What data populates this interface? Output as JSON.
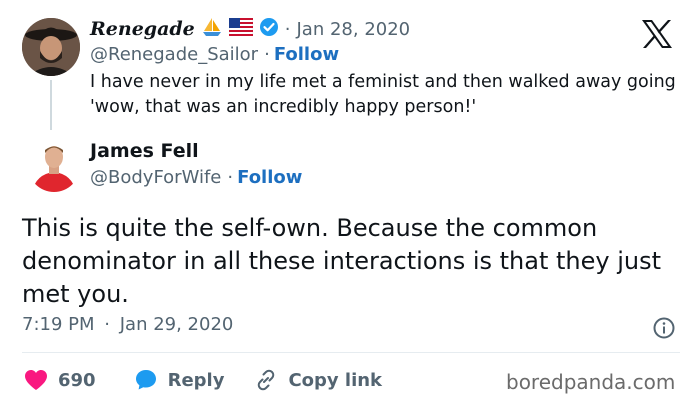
{
  "quoted_tweet": {
    "author_name": "Renegade",
    "emojis": [
      "sailboat",
      "us-flag"
    ],
    "date": "Jan 28, 2020",
    "handle": "@Renegade_Sailor",
    "follow_label": "Follow",
    "text": "I have never in my life met a feminist and then walked away going 'wow, that was an incredibly happy person!'"
  },
  "reply_tweet": {
    "author_name": "James Fell",
    "handle": "@BodyForWife",
    "follow_label": "Follow",
    "text": "This is quite the self-own. Because the common denominator in all these interactions is that they just met you.",
    "time": "7:19 PM",
    "date": "Jan 29, 2020",
    "likes": "690",
    "reply_label": "Reply",
    "copy_link_label": "Copy link"
  },
  "separator": "·",
  "watermark": "boredpanda.com",
  "colors": {
    "accent": "#1d6fc0",
    "like": "#f91880",
    "reply_icon": "#1d9bf0",
    "secondary": "#536471"
  }
}
